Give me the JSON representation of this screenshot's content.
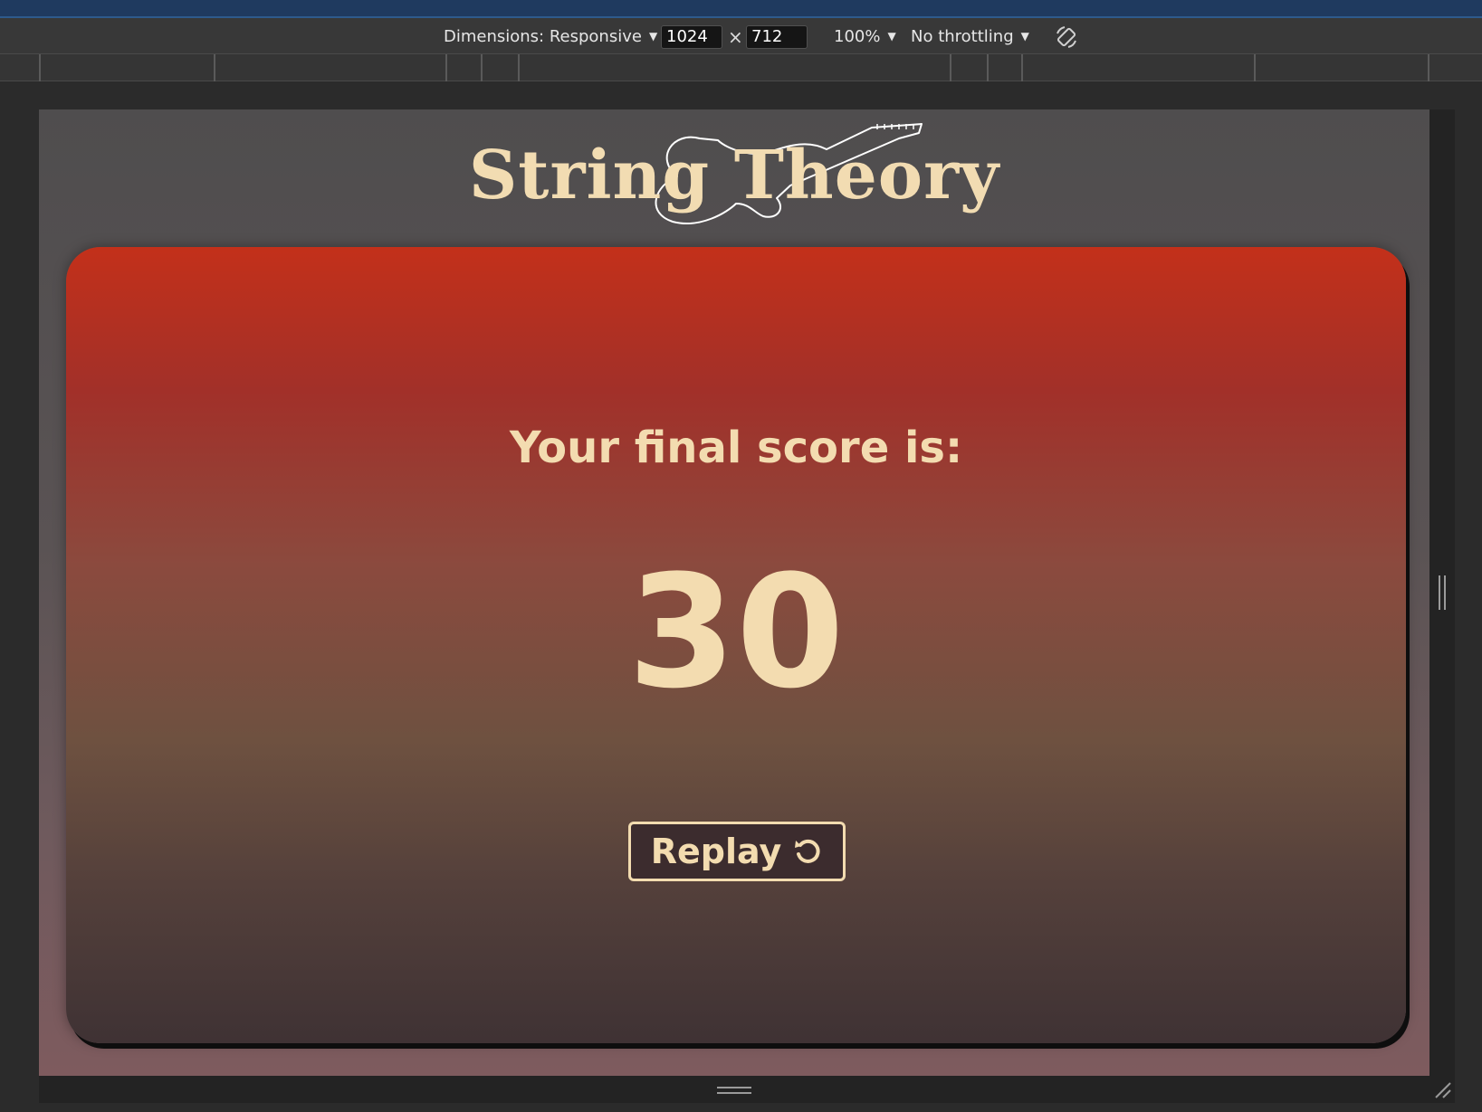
{
  "devtools": {
    "dimensions_label": "Dimensions: Responsive",
    "width_value": "1024",
    "height_value": "712",
    "times_symbol": "×",
    "zoom_label": "100%",
    "throttling_label": "No throttling"
  },
  "app": {
    "logo_text": "String Theory",
    "score_label": "Your final score is:",
    "score_value": "30",
    "replay_label": "Replay"
  },
  "colors": {
    "accent_text": "#f3dcb0",
    "card_top": "#c3301a",
    "card_bottom": "#3f3234",
    "button_bg": "#3c2c2e"
  },
  "icons": {
    "rotate": "rotate-device-icon",
    "replay": "replay-arrow-icon",
    "guitar": "guitar-outline-icon"
  }
}
